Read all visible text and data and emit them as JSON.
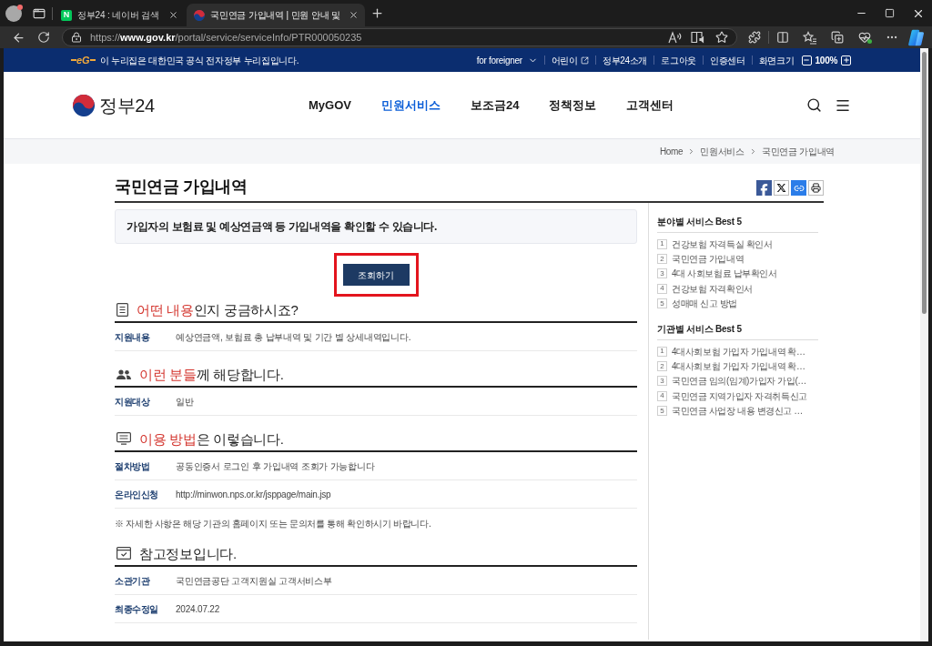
{
  "browser": {
    "tabs": [
      {
        "kind": "letter",
        "favicon_letter": "N",
        "title": "정부24 : 네이버 검색",
        "selected": false
      },
      {
        "kind": "emblem",
        "title": "국민연금 가입내역 | 민원 안내 및",
        "selected": true
      }
    ],
    "address": {
      "scheme": "https://",
      "host": "www.gov.kr",
      "path": "/portal/service/serviceInfo/PTR000050235"
    }
  },
  "banner": {
    "logo_text": "eG",
    "notice": "이 누리집은 대한민국 공식 전자정부 누리집입니다.",
    "links": [
      {
        "label": "for foreigner",
        "kind": "dropdown"
      },
      {
        "label": "어린이",
        "kind": "external"
      },
      {
        "label": "정부24소개",
        "kind": "plain"
      },
      {
        "label": "로그아웃",
        "kind": "plain"
      },
      {
        "label": "인증센터",
        "kind": "plain"
      },
      {
        "label": "화면크기",
        "kind": "plain"
      }
    ],
    "zoom_level": "100%"
  },
  "header": {
    "logo_text": "정부24",
    "nav": [
      {
        "label": "MyGOV",
        "selected": false
      },
      {
        "label": "민원서비스",
        "selected": true
      },
      {
        "label": "보조금24",
        "selected": false
      },
      {
        "label": "정책정보",
        "selected": false
      },
      {
        "label": "고객센터",
        "selected": false
      }
    ]
  },
  "breadcrumb": [
    "Home",
    "민원서비스",
    "국민연금 가입내역"
  ],
  "page": {
    "title": "국민연금 가입내역",
    "summary": "가입자의 보험료 및 예상연금액 등 가입내역을 확인할 수 있습니다.",
    "action": {
      "label": "조회하기",
      "highlighted": true
    },
    "sections": [
      {
        "kind": "document",
        "highlight": "어떤 내용",
        "heading": "인지 궁금하시죠?",
        "rows": [
          {
            "label": "지원내용",
            "value": "예상연금액, 보험료 총 납부내역 및 기간 별 상세내역입니다."
          }
        ]
      },
      {
        "kind": "people",
        "highlight": "이런 분들",
        "heading": "께 해당합니다.",
        "rows": [
          {
            "label": "지원대상",
            "value": "일반"
          }
        ]
      },
      {
        "kind": "screen",
        "highlight": "이용 방법",
        "heading": "은 이렇습니다.",
        "rows": [
          {
            "label": "절차방법",
            "value": "공동인증서 로그인 후 가입내역 조회가 가능합니다"
          },
          {
            "label": "온라인신청",
            "value": "http://minwon.nps.or.kr/jsppage/main.jsp"
          }
        ],
        "note": "※ 자세한 사항은 해당 기관의 홈페이지 또는 문의처를 통해 확인하시기 바랍니다."
      },
      {
        "kind": "calendar",
        "heading": "참고정보입니다.",
        "rows": [
          {
            "label": "소관기관",
            "value": "국민연금공단 고객지원실 고객서비스부"
          },
          {
            "label": "최종수정일",
            "value": "2024.07.22"
          }
        ]
      }
    ]
  },
  "sidebar": {
    "groups": [
      {
        "title": "분야별 서비스 Best 5",
        "items": [
          {
            "number": "1",
            "label": "건강보험 자격득실 확인서"
          },
          {
            "number": "2",
            "label": "국민연금 가입내역"
          },
          {
            "number": "3",
            "label": "4대 사회보험료 납부확인서"
          },
          {
            "number": "4",
            "label": "건강보험 자격확인서"
          },
          {
            "number": "5",
            "label": "성매매 신고 방법"
          }
        ]
      },
      {
        "title": "기관별 서비스 Best 5",
        "items": [
          {
            "number": "1",
            "label": "4대사회보험 가입자 가입내역 확…"
          },
          {
            "number": "2",
            "label": "4대사회보험 가입자 가입내역 확…"
          },
          {
            "number": "3",
            "label": "국민연금 임의(임계)가입자 가입(…"
          },
          {
            "number": "4",
            "label": "국민연금 지역가입자 자격취득신고"
          },
          {
            "number": "5",
            "label": "국민연금 사업장 내용 변경신고 …"
          }
        ]
      }
    ]
  }
}
